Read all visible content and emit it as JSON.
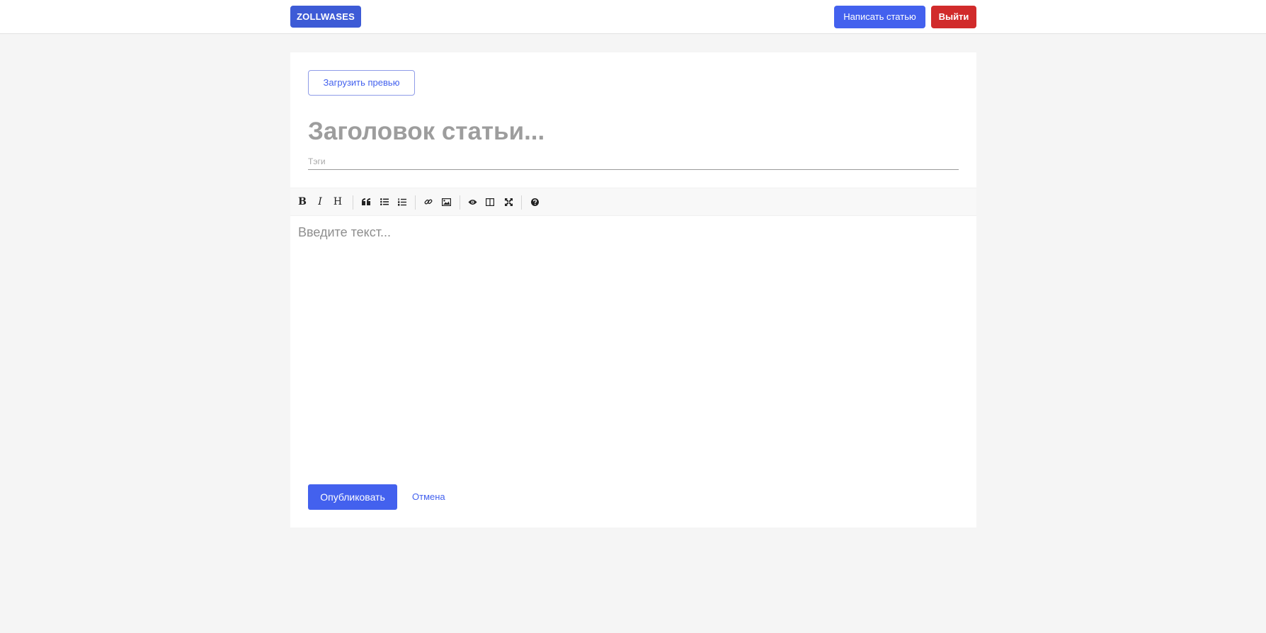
{
  "header": {
    "logo": "ZOLLWASES",
    "write_label": "Написать статью",
    "exit_label": "Выйти"
  },
  "editor_form": {
    "preview_label": "Загрузить превью",
    "title_placeholder": "Заголовок статьи...",
    "title_value": "",
    "tags_placeholder": "Тэги",
    "tags_value": "",
    "body_placeholder": "Введите текст...",
    "body_value": "",
    "publish_label": "Опубликовать",
    "cancel_label": "Отмена"
  },
  "toolbar": {
    "bold_glyph": "B",
    "italic_glyph": "I",
    "heading_glyph": "H",
    "icons": [
      "bold-icon",
      "italic-icon",
      "heading-icon",
      "quote-icon",
      "unordered-list-icon",
      "ordered-list-icon",
      "link-icon",
      "image-icon",
      "preview-icon",
      "side-by-side-icon",
      "fullscreen-icon",
      "help-icon"
    ]
  },
  "colors": {
    "accent": "#4361ee",
    "logo_bg": "#3d5bd6",
    "danger": "#d12b2b",
    "page_bg": "#f5f5f5"
  }
}
